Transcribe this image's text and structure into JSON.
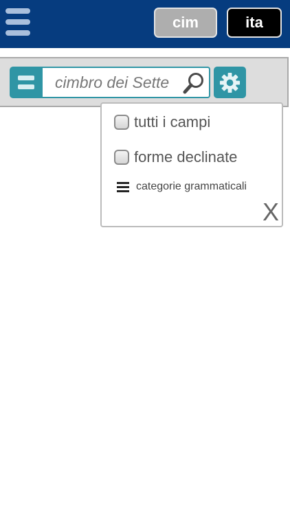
{
  "header": {
    "background": "#063c7f",
    "languages": [
      {
        "label": "cim",
        "active": false
      },
      {
        "label": "ita",
        "active": true
      }
    ]
  },
  "search": {
    "placeholder": "cimbro dei Sette",
    "value": "",
    "accent": "#2f95a5"
  },
  "options": {
    "items": [
      {
        "label": "tutti i campi",
        "checked": false
      },
      {
        "label": "forme declinate",
        "checked": false
      }
    ],
    "categories_label": "categorie grammaticali",
    "close_label": "X"
  },
  "icons": [
    "menu-icon",
    "list-icon",
    "search-icon",
    "gear-icon",
    "close-icon"
  ]
}
